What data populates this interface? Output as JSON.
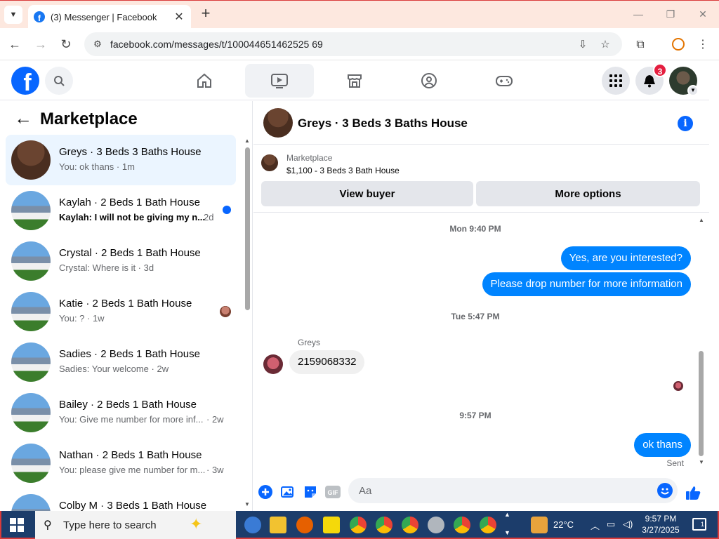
{
  "browser": {
    "tab_title": "(3) Messenger | Facebook",
    "url": "facebook.com/messages/t/100044651462525 69"
  },
  "facebook": {
    "notification_count": "3"
  },
  "left_panel": {
    "title": "Marketplace",
    "conversations": [
      {
        "name": "Greys · 3 Beds 3 Baths House",
        "preview": "You: ok thans · 1m",
        "active": true
      },
      {
        "name": "Kaylah · 2 Beds 1 Bath House",
        "preview": "Kaylah: I will not be giving my n...",
        "time": "2d",
        "unread": true
      },
      {
        "name": "Crystal · 2 Beds 1 Bath House",
        "preview": "Crystal: Where is it · 3d"
      },
      {
        "name": "Katie · 2 Beds 1 Bath House",
        "preview": "You: ? · 1w"
      },
      {
        "name": "Sadies · 2 Beds 1 Bath House",
        "preview": "Sadies: Your welcome · 2w"
      },
      {
        "name": "Bailey · 2 Beds 1 Bath House",
        "preview": "You: Give me number for more inf...",
        "time": "· 2w"
      },
      {
        "name": "Nathan · 2 Beds 1 Bath House",
        "preview": "You: please give me number for m...",
        "time": "· 3w"
      },
      {
        "name": "Colby M · 3 Beds 1 Bath House",
        "preview": ""
      }
    ]
  },
  "chat": {
    "title": "Greys · 3 Beds 3 Baths House",
    "listing_source": "Marketplace",
    "listing_price": "$1,100 - 3 Beds 3 Bath House",
    "view_buyer": "View buyer",
    "more_options": "More options",
    "timestamp_1": "Mon 9:40 PM",
    "out_1": "Yes, are you interested?",
    "out_2": "Please drop number for more information",
    "timestamp_2": "Tue 5:47 PM",
    "sender": "Greys",
    "in_1": "2159068332",
    "timestamp_3": "9:57 PM",
    "out_3": "ok thans",
    "sent": "Sent",
    "composer_placeholder": "Aa"
  },
  "taskbar": {
    "search_placeholder": "Type here to search",
    "temperature": "22°C",
    "time": "9:57 PM",
    "date": "3/27/2025",
    "notification_count": "1"
  },
  "colors": {
    "fb_blue": "#0866ff",
    "bubble_blue": "#0084ff",
    "active_conv": "#ebf5ff"
  }
}
